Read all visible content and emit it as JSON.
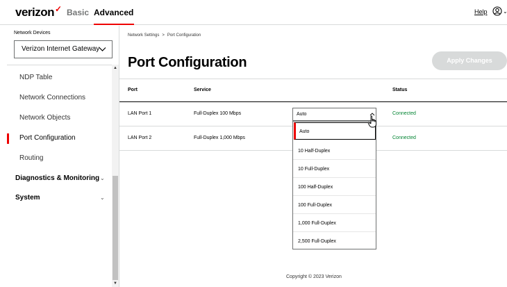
{
  "header": {
    "logo": "verizon",
    "logo_mark": "✓",
    "tabs": [
      {
        "label": "Basic",
        "active": false
      },
      {
        "label": "Advanced",
        "active": true
      }
    ],
    "help": "Help",
    "user_icon": "user-circle-icon"
  },
  "sidebar": {
    "section_label": "Network Devices",
    "device_select": "Verizon Internet Gateway",
    "items": [
      {
        "label": "NDP Table"
      },
      {
        "label": "Network Connections"
      },
      {
        "label": "Network Objects"
      },
      {
        "label": "Port Configuration",
        "active": true
      },
      {
        "label": "Routing"
      }
    ],
    "groups": [
      {
        "label": "Diagnostics & Monitoring"
      },
      {
        "label": "System"
      }
    ]
  },
  "main": {
    "breadcrumb": [
      "Network Settings",
      "Port Configuration"
    ],
    "breadcrumb_sep": ">",
    "title": "Port Configuration",
    "apply_button": "Apply Changes",
    "columns": [
      "Port",
      "Service",
      "Status"
    ],
    "rows": [
      {
        "port": "LAN Port 1",
        "service": "Full-Duplex 100 Mbps",
        "setting": "Auto",
        "status": "Connected"
      },
      {
        "port": "LAN Port 2",
        "service": "Full-Duplex 1,000 Mbps",
        "setting": "",
        "status": "Connected"
      }
    ],
    "dropdown_options": [
      "Auto",
      "10 Half-Duplex",
      "10 Full-Duplex",
      "100 Half-Duplex",
      "100 Full-Duplex",
      "1,000 Full-Duplex",
      "2,500 Full-Duplex"
    ],
    "dropdown_selected": "Auto"
  },
  "footer": {
    "copyright": "Copyright © 2023 Verizon"
  },
  "colors": {
    "brand_red": "#ee0000",
    "status_green": "#008331",
    "disabled_button": "#d8dada"
  }
}
